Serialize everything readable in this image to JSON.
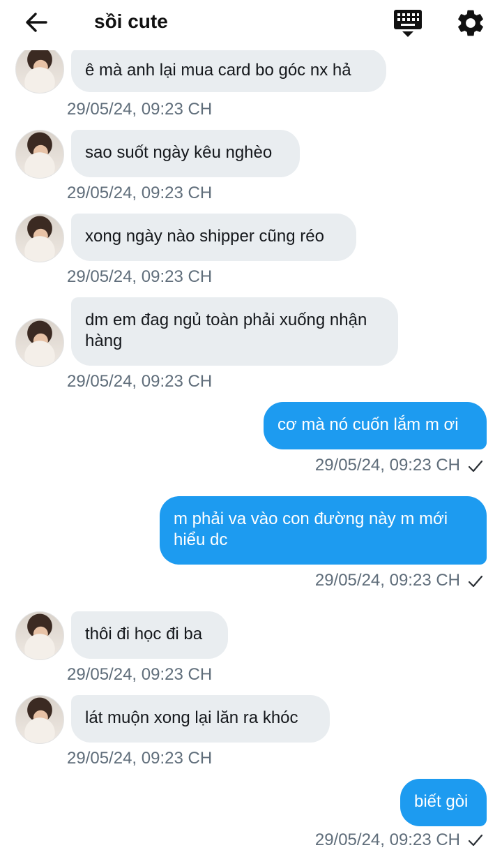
{
  "header": {
    "back_icon": "arrow-left-icon",
    "title": "sồi cute",
    "keyboard_icon": "keyboard-hide-icon",
    "settings_icon": "gear-icon"
  },
  "colors": {
    "incoming_bubble": "#e9edf0",
    "outgoing_bubble": "#1d9bf0",
    "timestamp": "#5f6d7a"
  },
  "messages": [
    {
      "direction": "in",
      "text": "ê mà anh lại mua card bo góc nx hả",
      "time": "29/05/24, 09:23 CH"
    },
    {
      "direction": "in",
      "text": "sao suốt ngày kêu nghèo",
      "time": "29/05/24, 09:23 CH"
    },
    {
      "direction": "in",
      "text": "xong ngày nào shipper cũng réo",
      "time": "29/05/24, 09:23 CH"
    },
    {
      "direction": "in",
      "text": "dm em đag ngủ toàn phải xuống nhận hàng",
      "time": "29/05/24, 09:23 CH"
    },
    {
      "direction": "out",
      "text": "cơ mà nó cuốn lắm m ơi",
      "time": "29/05/24, 09:23 CH",
      "status_icon": "check-icon"
    },
    {
      "direction": "out",
      "text": "m phải va vào con đường này m mới hiểu dc",
      "time": "29/05/24, 09:23 CH",
      "status_icon": "check-icon"
    },
    {
      "direction": "in",
      "text": "thôi đi học đi ba",
      "time": "29/05/24, 09:23 CH"
    },
    {
      "direction": "in",
      "text": "lát muộn xong lại lăn ra khóc",
      "time": "29/05/24, 09:23 CH"
    },
    {
      "direction": "out",
      "text": "biết gòi",
      "time": "29/05/24, 09:23 CH",
      "status_icon": "check-icon"
    }
  ]
}
